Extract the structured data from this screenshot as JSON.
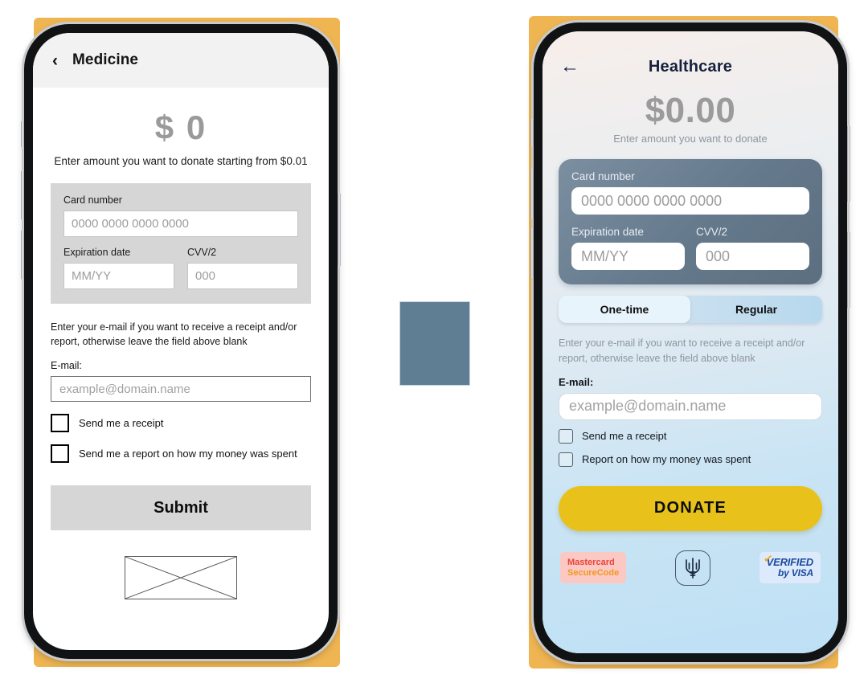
{
  "canvas": {
    "background": "#ffffff",
    "backdrop_color": "#efb553",
    "center_block_color": "#5f7e94"
  },
  "wireframe_phone": {
    "header": {
      "back_icon": "chevron-left-icon",
      "back_glyph": "‹",
      "title": "Medicine"
    },
    "amount": {
      "value": "$ 0",
      "hint": "Enter amount you want to donate starting from $0.01"
    },
    "card_panel": {
      "card_number_label": "Card number",
      "card_number_placeholder": "0000 0000 0000 0000",
      "expiration_label": "Expiration date",
      "expiration_placeholder": "MM/YY",
      "cvv_label": "CVV/2",
      "cvv_placeholder": "000"
    },
    "email_section": {
      "note": "Enter your e-mail if you want to receive a receipt and/or report, otherwise leave the field above blank",
      "label": "E-mail:",
      "placeholder": "example@domain.name"
    },
    "checkboxes": [
      {
        "label": "Send me a receipt",
        "checked": false
      },
      {
        "label": "Send me a report on how my money was spent",
        "checked": false
      }
    ],
    "submit_label": "Submit",
    "image_placeholder": "image-placeholder-crossed-box"
  },
  "hifi_phone": {
    "header": {
      "back_icon": "arrow-left-icon",
      "back_glyph": "←",
      "title": "Healthcare"
    },
    "amount": {
      "value": "$0.00",
      "hint": "Enter amount you want to donate"
    },
    "card_panel": {
      "card_number_label": "Card number",
      "card_number_placeholder": "0000 0000 0000 0000",
      "expiration_label": "Expiration date",
      "expiration_placeholder": "MM/YY",
      "cvv_label": "CVV/2",
      "cvv_placeholder": "000"
    },
    "frequency_toggle": {
      "options": [
        "One-time",
        "Regular"
      ],
      "selected": "One-time"
    },
    "email_section": {
      "note": "Enter your e-mail if you want to receive a receipt and/or report, otherwise leave the field above blank",
      "label": "E-mail:",
      "placeholder": "example@domain.name"
    },
    "checkboxes": [
      {
        "label": "Send me a receipt",
        "checked": false
      },
      {
        "label": "Report on how my money was spent",
        "checked": false
      }
    ],
    "donate_label": "DONATE",
    "donate_color": "#e8c21a",
    "badges": [
      {
        "name": "mastercard-securecode-badge",
        "line1": "Mastercard",
        "line2": "SecureCode"
      },
      {
        "name": "ukraine-tryzub-badge"
      },
      {
        "name": "verified-by-visa-badge",
        "line1": "VERIFIED",
        "line2": "by VISA"
      }
    ]
  }
}
